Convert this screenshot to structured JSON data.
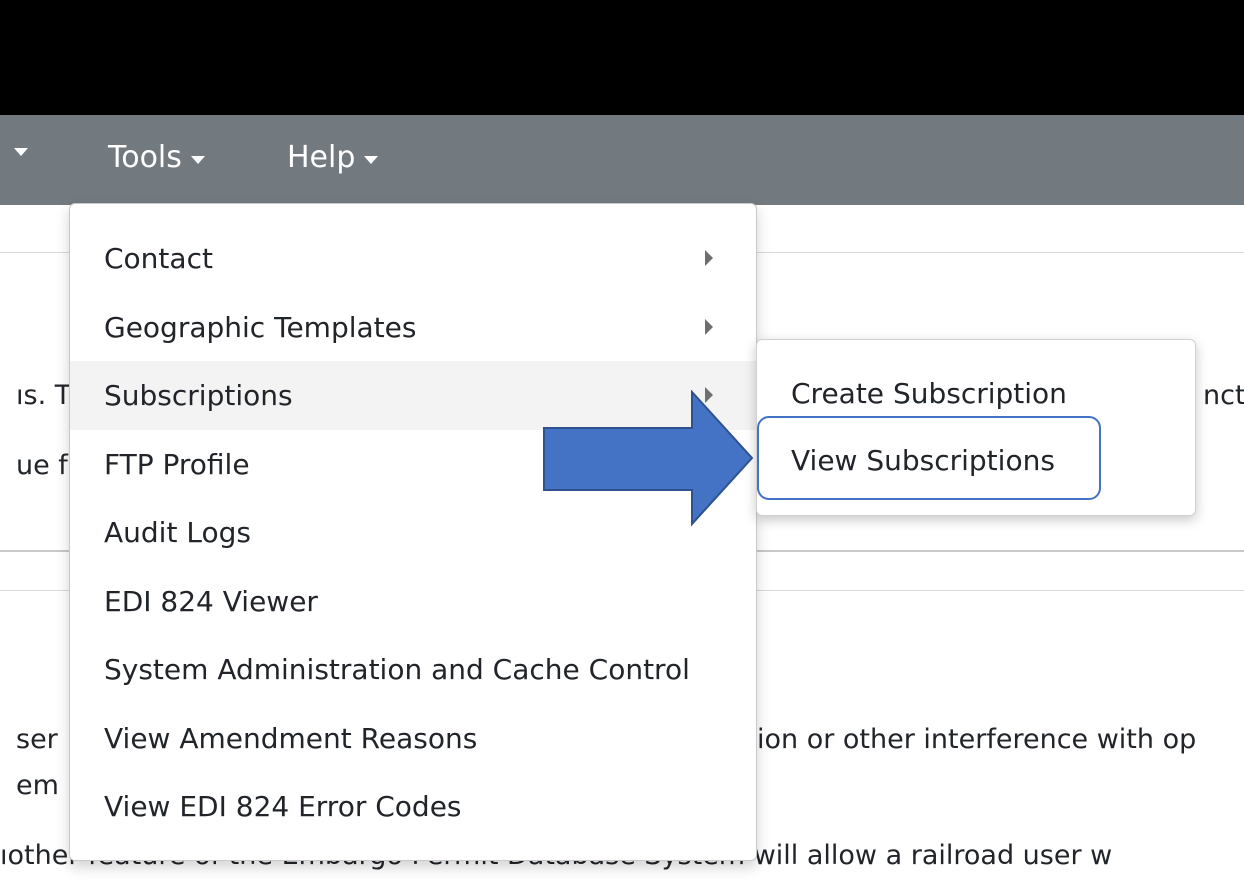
{
  "nav": {
    "tools": "Tools",
    "help": "Help"
  },
  "background": {
    "line1_left": "ıs. T",
    "line2_left": "ue f",
    "line1_right": "nct",
    "line3_left": "ser",
    "line3_right": "ion or other interference with op",
    "line4_left": "em",
    "line5": "ıother feature of the Embargo Permit Database System will allow a railroad user w"
  },
  "tools_menu": {
    "items": [
      {
        "label": "Contact",
        "submenu": true
      },
      {
        "label": "Geographic Templates",
        "submenu": true
      },
      {
        "label": "Subscriptions",
        "submenu": true
      },
      {
        "label": "FTP Profile",
        "submenu": false
      },
      {
        "label": "Audit Logs",
        "submenu": false
      },
      {
        "label": "EDI 824 Viewer",
        "submenu": false
      },
      {
        "label": "System Administration and Cache Control",
        "submenu": false
      },
      {
        "label": "View Amendment Reasons",
        "submenu": false
      },
      {
        "label": "View EDI 824 Error Codes",
        "submenu": false
      }
    ]
  },
  "subscriptions_submenu": {
    "items": [
      {
        "label": "Create Subscription"
      },
      {
        "label": "View Subscriptions"
      }
    ]
  },
  "colors": {
    "topbar": "#000000",
    "navbar": "#727a80",
    "callout_arrow": "#4472c4",
    "highlight_outline": "#4472c4"
  }
}
